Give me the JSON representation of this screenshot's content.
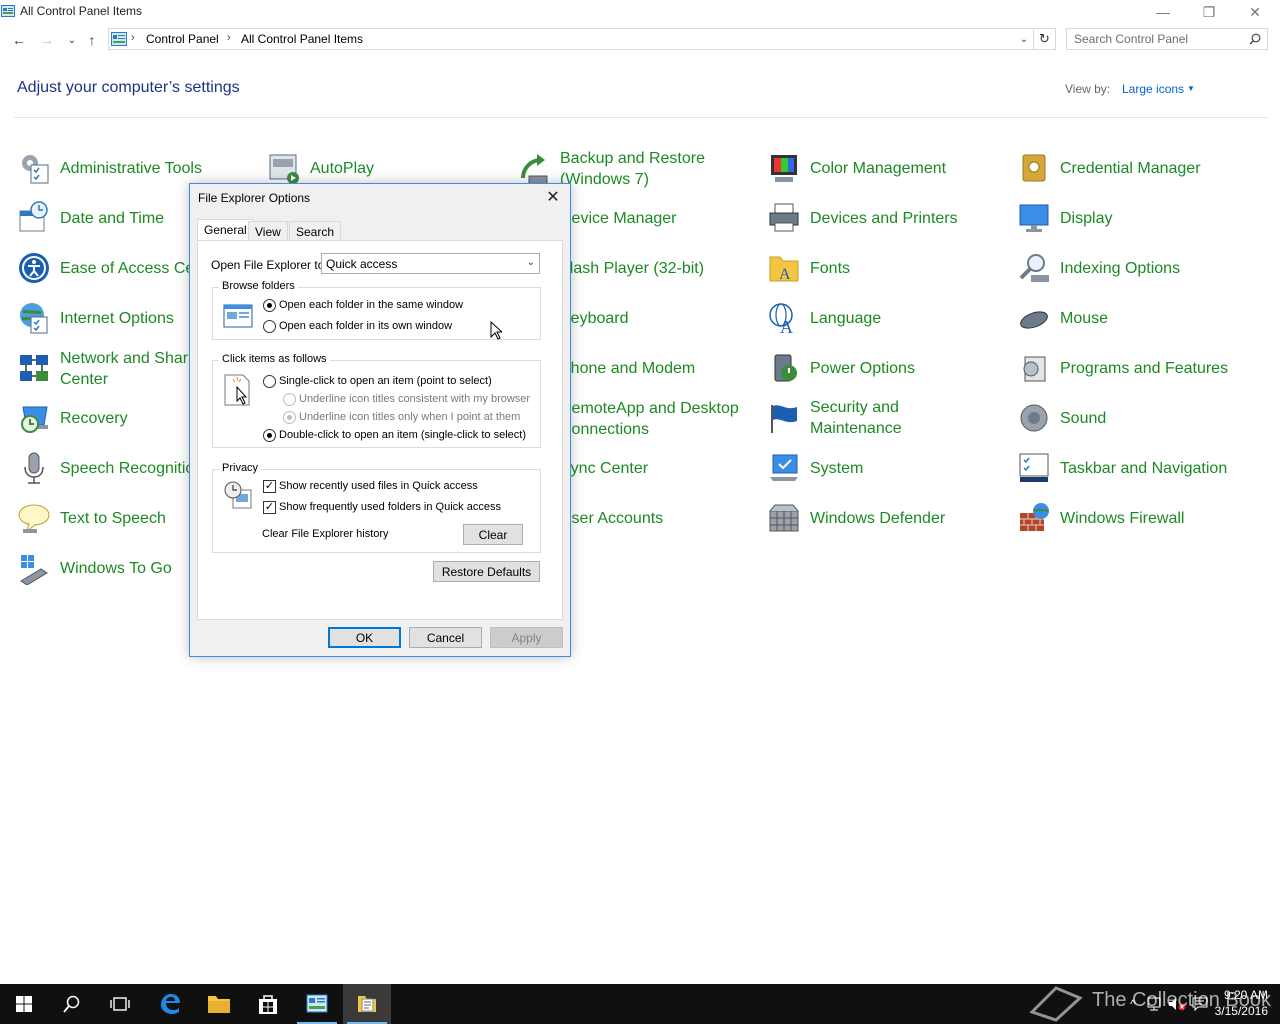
{
  "window": {
    "title": "All Control Panel Items",
    "minimize_label": "—",
    "restore_label": "❐",
    "close_label": "✕"
  },
  "nav": {
    "back": "←",
    "forward": "→",
    "recent": "⌄",
    "up": "↑",
    "refresh": "↻",
    "breadcrumb_sep": "›",
    "breadcrumb": [
      "Control Panel",
      "All Control Panel Items"
    ],
    "search_placeholder": "Search Control Panel"
  },
  "header": {
    "title": "Adjust your computer’s settings",
    "view_by_label": "View by:",
    "view_by_value": "Large icons"
  },
  "items": [
    {
      "label": "Administrative Tools",
      "icon": "admin-tools-icon"
    },
    {
      "label": "AutoPlay",
      "icon": "autoplay-icon"
    },
    {
      "label": "Backup and Restore (Windows 7)",
      "icon": "backup-icon"
    },
    {
      "label": "Color Management",
      "icon": "color-management-icon"
    },
    {
      "label": "Credential Manager",
      "icon": "credential-icon"
    },
    {
      "label": "Date and Time",
      "icon": "calendar-icon"
    },
    {
      "label": "Device Manager",
      "icon": "device-manager-icon"
    },
    {
      "label": "Devices and Printers",
      "icon": "printer-icon"
    },
    {
      "label": "Display",
      "icon": "display-icon"
    },
    {
      "label": "Ease of Access Center",
      "icon": "ease-of-access-icon"
    },
    {
      "label": "Flash Player (32-bit)",
      "icon": "flash-icon"
    },
    {
      "label": "Fonts",
      "icon": "fonts-icon"
    },
    {
      "label": "Indexing Options",
      "icon": "indexing-icon"
    },
    {
      "label": "Internet Options",
      "icon": "internet-options-icon"
    },
    {
      "label": "Keyboard",
      "icon": "keyboard-icon"
    },
    {
      "label": "Language",
      "icon": "language-icon"
    },
    {
      "label": "Mouse",
      "icon": "mouse-icon"
    },
    {
      "label": "Network and Sharing Center",
      "icon": "network-icon"
    },
    {
      "label": "Phone and Modem",
      "icon": "phone-icon"
    },
    {
      "label": "Power Options",
      "icon": "power-icon"
    },
    {
      "label": "Programs and Features",
      "icon": "programs-icon"
    },
    {
      "label": "Recovery",
      "icon": "recovery-icon"
    },
    {
      "label": "RemoteApp and Desktop Connections",
      "icon": "remoteapp-icon"
    },
    {
      "label": "Security and Maintenance",
      "icon": "flag-icon"
    },
    {
      "label": "Sound",
      "icon": "speaker-icon"
    },
    {
      "label": "Speech Recognition",
      "icon": "microphone-icon"
    },
    {
      "label": "Sync Center",
      "icon": "sync-icon"
    },
    {
      "label": "System",
      "icon": "system-icon"
    },
    {
      "label": "Taskbar and Navigation",
      "icon": "taskbar-icon"
    },
    {
      "label": "Text to Speech",
      "icon": "speech-bubble-icon"
    },
    {
      "label": "User Accounts",
      "icon": "users-icon"
    },
    {
      "label": "Windows Defender",
      "icon": "defender-icon"
    },
    {
      "label": "Windows Firewall",
      "icon": "firewall-icon"
    },
    {
      "label": "Windows To Go",
      "icon": "usb-drive-icon"
    }
  ],
  "dialog": {
    "title": "File Explorer Options",
    "close": "✕",
    "tabs": [
      "General",
      "View",
      "Search"
    ],
    "open_to_label": "Open File Explorer to:",
    "open_to_value": "Quick access",
    "browse_group": "Browse folders",
    "browse_same": "Open each folder in the same window",
    "browse_own": "Open each folder in its own window",
    "click_group": "Click items as follows",
    "single_click": "Single-click to open an item (point to select)",
    "underline_browser": "Underline icon titles consistent with my browser",
    "underline_point": "Underline icon titles only when I point at them",
    "double_click": "Double-click to open an item (single-click to select)",
    "privacy_group": "Privacy",
    "recent_files": "Show recently used files in Quick access",
    "frequent_folders": "Show frequently used folders in Quick access",
    "clear_history_label": "Clear File Explorer history",
    "clear_button": "Clear",
    "restore_button": "Restore Defaults",
    "ok": "OK",
    "cancel": "Cancel",
    "apply": "Apply"
  },
  "taskbar": {
    "clock_time": "9:20 AM",
    "clock_date": "3/15/2016",
    "watermark": "The Collection Book"
  }
}
